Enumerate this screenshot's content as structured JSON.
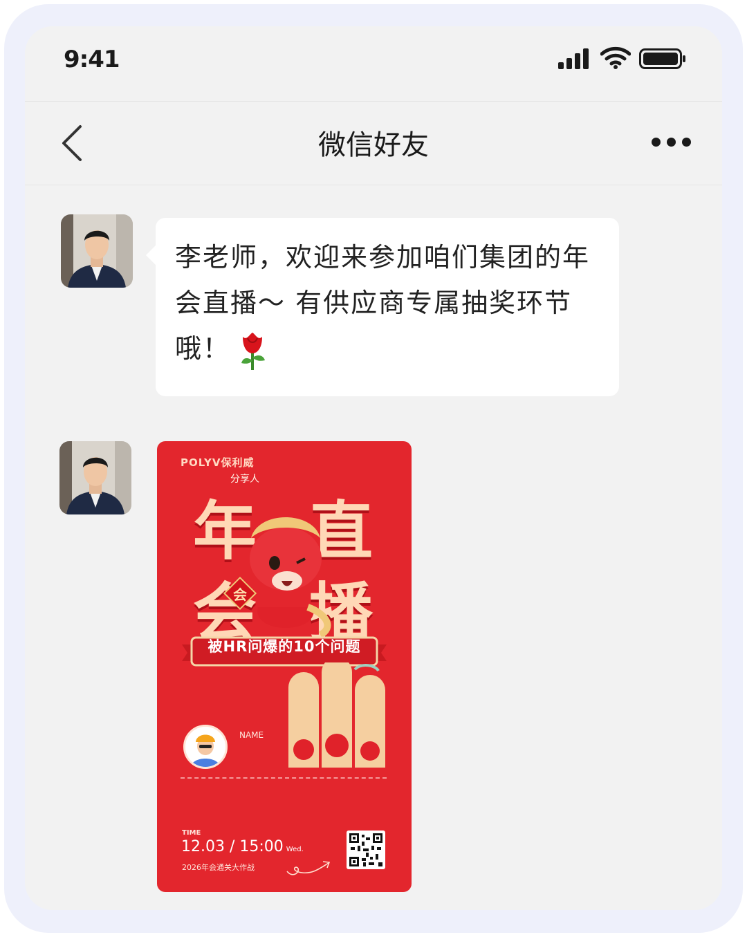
{
  "status_bar": {
    "time": "9:41"
  },
  "nav": {
    "title": "微信好友"
  },
  "messages": [
    {
      "type": "text",
      "sender": "李老师",
      "text": "李老师，欢迎来参加咱们集团的年会直播～ 有供应商专属抽奖环节哦！"
    },
    {
      "type": "poster",
      "poster": {
        "brand": "POLYV保利威",
        "sharer_label": "分享人",
        "title_chars": [
          "年",
          "直",
          "会",
          "播"
        ],
        "badge": "会",
        "ribbon": "被HR问爆的10个问题",
        "name_label": "NAME",
        "time_label": "TIME",
        "date": "12.03 / 15:00",
        "weekday": "Wed.",
        "subtitle": "2026年会通关大作战"
      }
    }
  ],
  "colors": {
    "poster_red": "#e3262d",
    "gold": "#ffd8b6",
    "background": "#f2f2f2"
  }
}
